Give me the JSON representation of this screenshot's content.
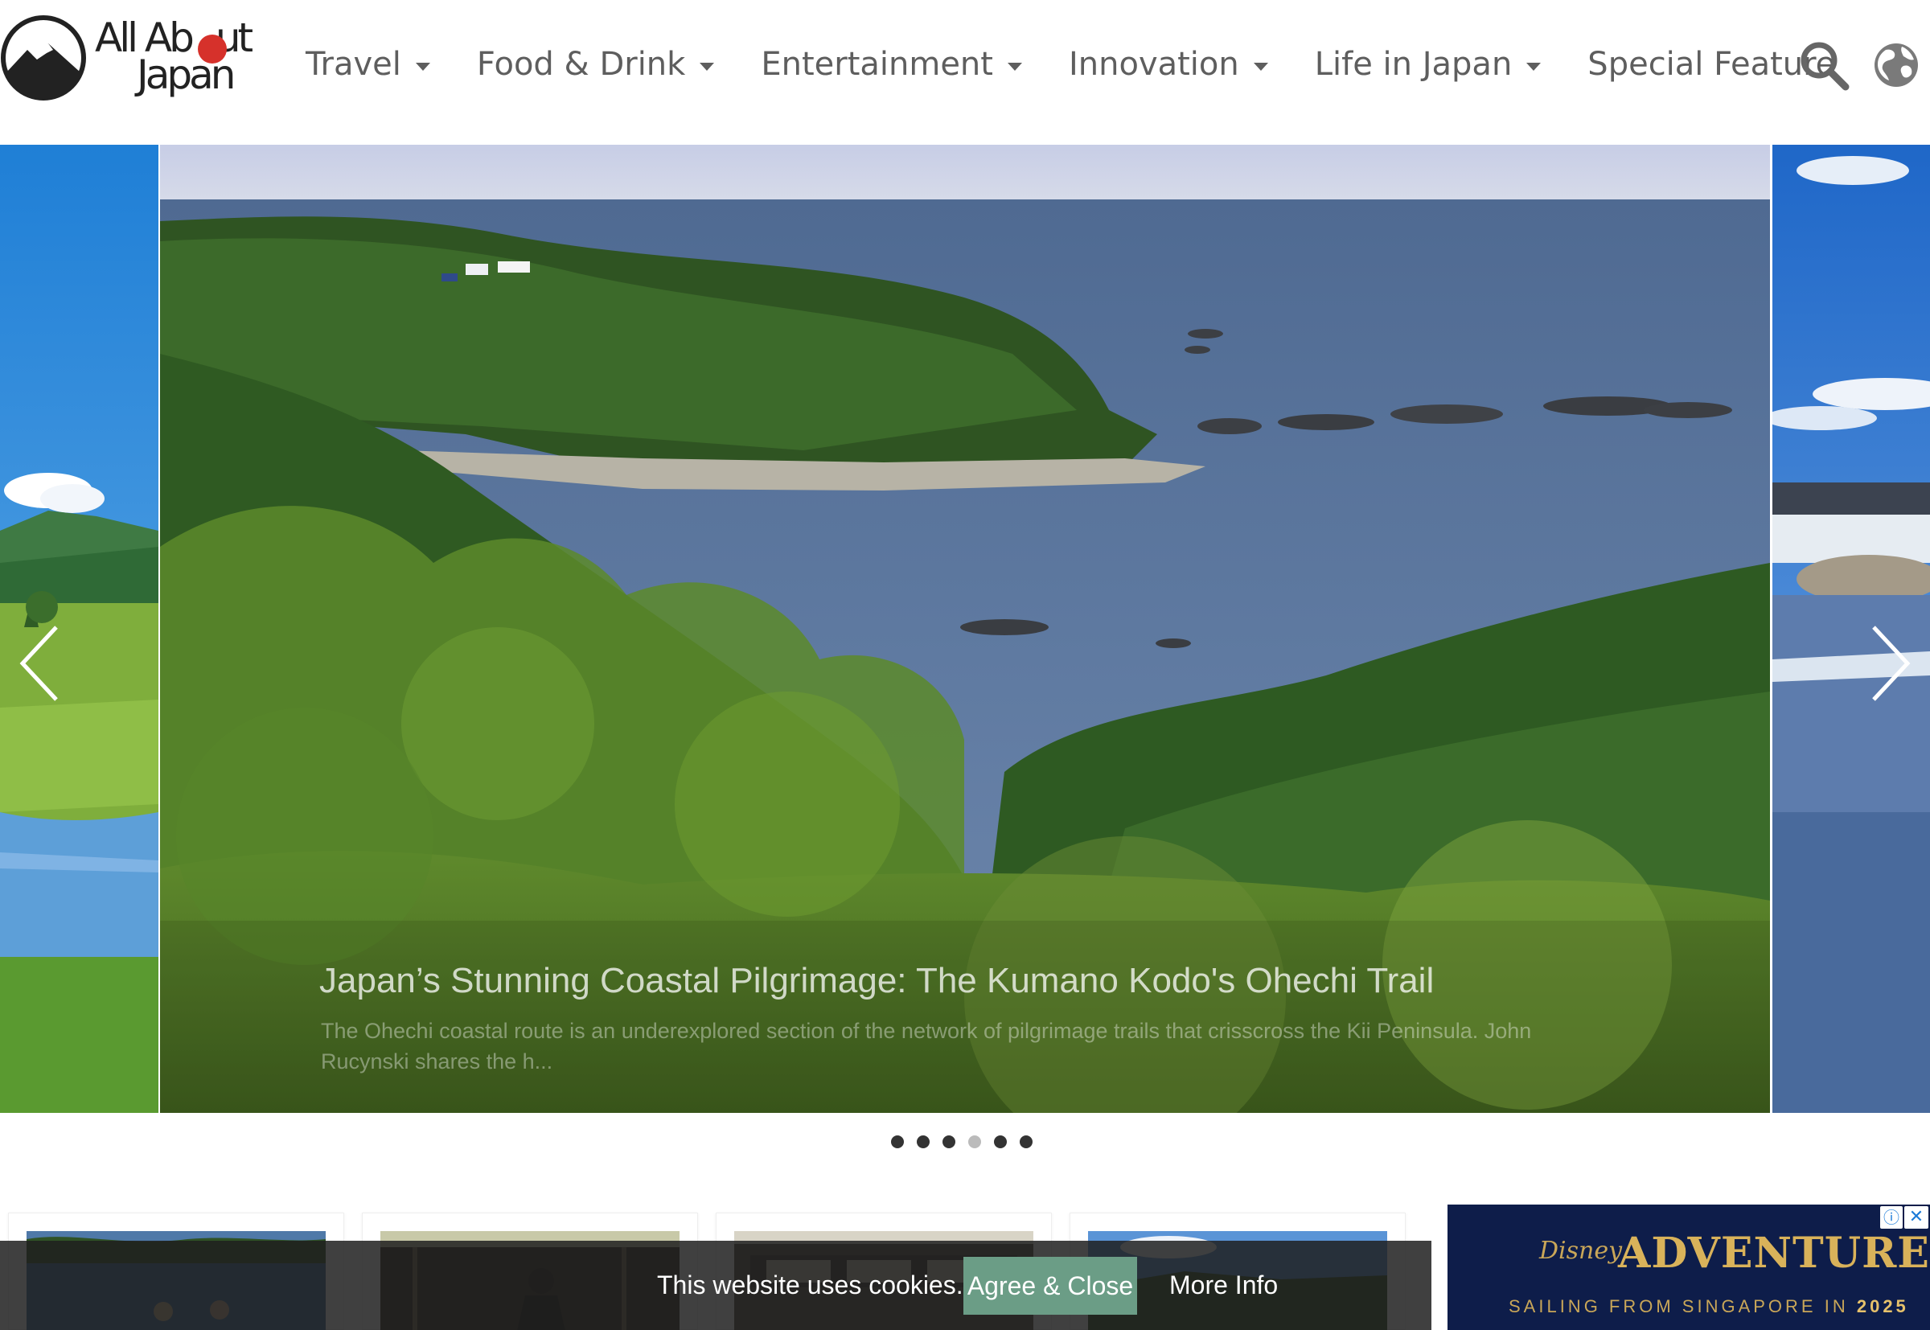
{
  "brand": {
    "logo_line1": "All Ab",
    "logo_line1_end": "ut",
    "logo_line2": "Japan",
    "accent_color": "#d6312b"
  },
  "nav": {
    "items": [
      {
        "label": "Travel",
        "has_dropdown": true
      },
      {
        "label": "Food & Drink",
        "has_dropdown": true
      },
      {
        "label": "Entertainment",
        "has_dropdown": true
      },
      {
        "label": "Innovation",
        "has_dropdown": true
      },
      {
        "label": "Life in Japan",
        "has_dropdown": true
      },
      {
        "label": "Special Feature",
        "has_dropdown": false
      }
    ],
    "search_icon": "search-icon",
    "language_icon": "globe-icon"
  },
  "hero": {
    "title": "Japan’s Stunning Coastal Pilgrimage: The Kumano Kodo's Ohechi Trail",
    "excerpt": "The Ohechi coastal route is an underexplored section of the network of pilgrimage trails that crisscross the Kii Peninsula. John Rucynski shares the h...",
    "slide_count": 6,
    "active_slide": 4,
    "prev_icon": "chevron-left-icon",
    "next_icon": "chevron-right-icon"
  },
  "ad": {
    "brand": "Disney",
    "title": "ADVENTURE",
    "subtitle": "SAILING FROM SINGAPORE IN",
    "year": "2025",
    "info_icon": "info-icon",
    "close_icon": "close-icon"
  },
  "cookie": {
    "message": "This website uses cookies.",
    "agree_label": "Agree & Close",
    "more_label": "More Info"
  }
}
